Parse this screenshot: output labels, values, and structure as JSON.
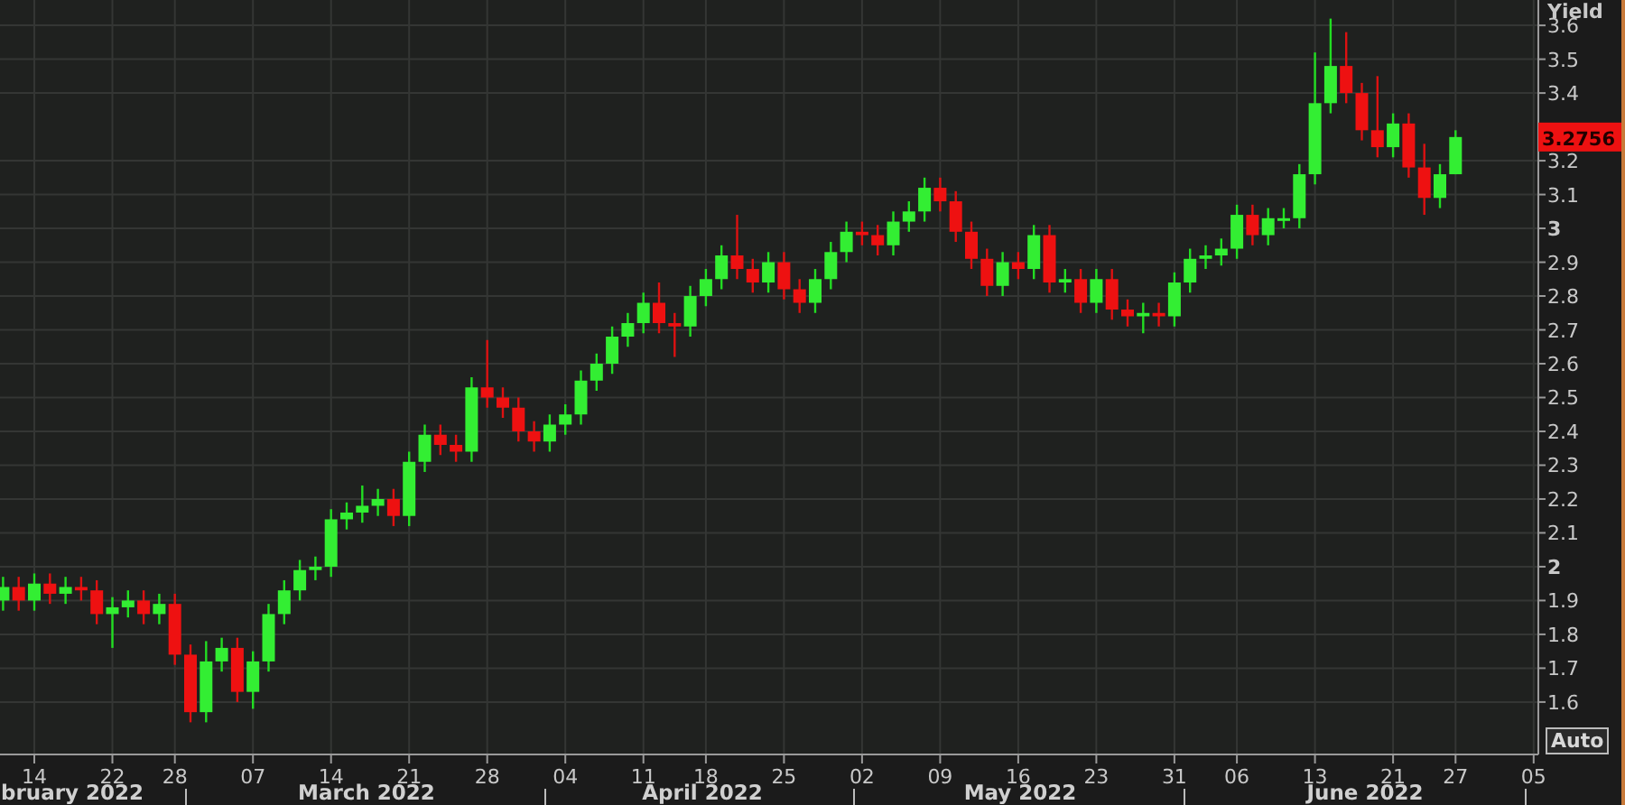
{
  "chart": {
    "last_price": "3.2756",
    "auto_button": "Auto",
    "months": [
      "bruary 2022",
      "March 2022",
      "April 2022",
      "May 2022",
      "June 2022"
    ],
    "chart_data": {
      "type": "candlestick",
      "ylabel": "Yield",
      "ylim": [
        1.445,
        3.675
      ],
      "grid": true,
      "yticks": [
        {
          "value": 1.6,
          "label": "1.6"
        },
        {
          "value": 1.7,
          "label": "1.7"
        },
        {
          "value": 1.8,
          "label": "1.8"
        },
        {
          "value": 1.9,
          "label": "1.9"
        },
        {
          "value": 2,
          "label": "2"
        },
        {
          "value": 2.1,
          "label": "2.1"
        },
        {
          "value": 2.2,
          "label": "2.2"
        },
        {
          "value": 2.3,
          "label": "2.3"
        },
        {
          "value": 2.4,
          "label": "2.4"
        },
        {
          "value": 2.5,
          "label": "2.5"
        },
        {
          "value": 2.6,
          "label": "2.6"
        },
        {
          "value": 2.7,
          "label": "2.7"
        },
        {
          "value": 2.8,
          "label": "2.8"
        },
        {
          "value": 2.9,
          "label": "2.9"
        },
        {
          "value": 3,
          "label": "3"
        },
        {
          "value": 3.1,
          "label": "3.1"
        },
        {
          "value": 3.2,
          "label": "3.2"
        },
        {
          "value": 3.4,
          "label": "3.4"
        },
        {
          "value": 3.5,
          "label": "3.5"
        },
        {
          "value": 3.6,
          "label": "3.6"
        }
      ],
      "categories": [
        null,
        null,
        "14",
        null,
        null,
        null,
        null,
        "22",
        null,
        null,
        null,
        "28",
        null,
        null,
        null,
        null,
        "07",
        null,
        null,
        null,
        null,
        "14",
        null,
        null,
        null,
        null,
        "21",
        null,
        null,
        null,
        null,
        "28",
        null,
        null,
        null,
        null,
        "04",
        null,
        null,
        null,
        null,
        "11",
        null,
        null,
        null,
        "18",
        null,
        null,
        null,
        null,
        "25",
        null,
        null,
        null,
        null,
        "02",
        null,
        null,
        null,
        null,
        "09",
        null,
        null,
        null,
        null,
        "16",
        null,
        null,
        null,
        null,
        "23",
        null,
        null,
        null,
        null,
        "31",
        null,
        null,
        null,
        "06",
        null,
        null,
        null,
        null,
        "13",
        null,
        null,
        null,
        null,
        "21",
        null,
        null,
        null,
        "27",
        null,
        null,
        null,
        null,
        "05"
      ],
      "ohlc": [
        [
          1.9,
          1.97,
          1.87,
          1.94
        ],
        [
          1.94,
          1.97,
          1.87,
          1.9
        ],
        [
          1.9,
          1.98,
          1.87,
          1.95
        ],
        [
          1.95,
          1.98,
          1.89,
          1.92
        ],
        [
          1.92,
          1.97,
          1.89,
          1.94
        ],
        [
          1.94,
          1.97,
          1.9,
          1.93
        ],
        [
          1.93,
          1.96,
          1.83,
          1.86
        ],
        [
          1.86,
          1.91,
          1.76,
          1.88
        ],
        [
          1.88,
          1.93,
          1.85,
          1.9
        ],
        [
          1.9,
          1.93,
          1.83,
          1.86
        ],
        [
          1.86,
          1.92,
          1.83,
          1.89
        ],
        [
          1.89,
          1.92,
          1.71,
          1.74
        ],
        [
          1.74,
          1.77,
          1.54,
          1.57
        ],
        [
          1.57,
          1.78,
          1.54,
          1.72
        ],
        [
          1.72,
          1.79,
          1.69,
          1.76
        ],
        [
          1.76,
          1.79,
          1.6,
          1.63
        ],
        [
          1.63,
          1.75,
          1.58,
          1.72
        ],
        [
          1.72,
          1.89,
          1.69,
          1.86
        ],
        [
          1.86,
          1.96,
          1.83,
          1.93
        ],
        [
          1.93,
          2.02,
          1.9,
          1.99
        ],
        [
          1.99,
          2.03,
          1.96,
          2.0
        ],
        [
          2.0,
          2.17,
          1.97,
          2.14
        ],
        [
          2.14,
          2.19,
          2.11,
          2.16
        ],
        [
          2.16,
          2.24,
          2.13,
          2.18
        ],
        [
          2.18,
          2.23,
          2.15,
          2.2
        ],
        [
          2.2,
          2.23,
          2.12,
          2.15
        ],
        [
          2.15,
          2.34,
          2.12,
          2.31
        ],
        [
          2.31,
          2.42,
          2.28,
          2.39
        ],
        [
          2.39,
          2.42,
          2.33,
          2.36
        ],
        [
          2.36,
          2.39,
          2.31,
          2.34
        ],
        [
          2.34,
          2.56,
          2.31,
          2.53
        ],
        [
          2.53,
          2.67,
          2.47,
          2.5
        ],
        [
          2.5,
          2.53,
          2.44,
          2.47
        ],
        [
          2.47,
          2.5,
          2.37,
          2.4
        ],
        [
          2.4,
          2.43,
          2.34,
          2.37
        ],
        [
          2.37,
          2.45,
          2.34,
          2.42
        ],
        [
          2.42,
          2.48,
          2.39,
          2.45
        ],
        [
          2.45,
          2.58,
          2.42,
          2.55
        ],
        [
          2.55,
          2.63,
          2.52,
          2.6
        ],
        [
          2.6,
          2.71,
          2.57,
          2.68
        ],
        [
          2.68,
          2.75,
          2.65,
          2.72
        ],
        [
          2.72,
          2.81,
          2.69,
          2.78
        ],
        [
          2.78,
          2.84,
          2.69,
          2.72
        ],
        [
          2.72,
          2.75,
          2.62,
          2.71
        ],
        [
          2.71,
          2.83,
          2.68,
          2.8
        ],
        [
          2.8,
          2.88,
          2.77,
          2.85
        ],
        [
          2.85,
          2.95,
          2.82,
          2.92
        ],
        [
          2.92,
          3.04,
          2.85,
          2.88
        ],
        [
          2.88,
          2.91,
          2.81,
          2.84
        ],
        [
          2.84,
          2.93,
          2.81,
          2.9
        ],
        [
          2.9,
          2.93,
          2.79,
          2.82
        ],
        [
          2.82,
          2.85,
          2.75,
          2.78
        ],
        [
          2.78,
          2.88,
          2.75,
          2.85
        ],
        [
          2.85,
          2.96,
          2.82,
          2.93
        ],
        [
          2.93,
          3.02,
          2.9,
          2.99
        ],
        [
          2.99,
          3.02,
          2.95,
          2.98
        ],
        [
          2.98,
          3.01,
          2.92,
          2.95
        ],
        [
          2.95,
          3.05,
          2.92,
          3.02
        ],
        [
          3.02,
          3.08,
          2.99,
          3.05
        ],
        [
          3.05,
          3.15,
          3.02,
          3.12
        ],
        [
          3.12,
          3.15,
          3.05,
          3.08
        ],
        [
          3.08,
          3.11,
          2.96,
          2.99
        ],
        [
          2.99,
          3.02,
          2.88,
          2.91
        ],
        [
          2.91,
          2.94,
          2.8,
          2.83
        ],
        [
          2.83,
          2.93,
          2.8,
          2.9
        ],
        [
          2.9,
          2.93,
          2.85,
          2.88
        ],
        [
          2.88,
          3.01,
          2.85,
          2.98
        ],
        [
          2.98,
          3.01,
          2.81,
          2.84
        ],
        [
          2.84,
          2.88,
          2.81,
          2.85
        ],
        [
          2.85,
          2.88,
          2.75,
          2.78
        ],
        [
          2.78,
          2.88,
          2.75,
          2.85
        ],
        [
          2.85,
          2.88,
          2.73,
          2.76
        ],
        [
          2.76,
          2.79,
          2.71,
          2.74
        ],
        [
          2.74,
          2.78,
          2.69,
          2.75
        ],
        [
          2.75,
          2.78,
          2.71,
          2.74
        ],
        [
          2.74,
          2.87,
          2.71,
          2.84
        ],
        [
          2.84,
          2.94,
          2.81,
          2.91
        ],
        [
          2.91,
          2.95,
          2.88,
          2.92
        ],
        [
          2.92,
          2.97,
          2.89,
          2.94
        ],
        [
          2.94,
          3.07,
          2.91,
          3.04
        ],
        [
          3.04,
          3.07,
          2.95,
          2.98
        ],
        [
          2.98,
          3.06,
          2.95,
          3.03
        ],
        [
          3.03,
          3.06,
          3.0,
          3.03
        ],
        [
          3.03,
          3.19,
          3.0,
          3.16
        ],
        [
          3.16,
          3.52,
          3.13,
          3.37
        ],
        [
          3.37,
          3.62,
          3.34,
          3.48
        ],
        [
          3.48,
          3.58,
          3.37,
          3.4
        ],
        [
          3.4,
          3.43,
          3.26,
          3.29
        ],
        [
          3.29,
          3.45,
          3.21,
          3.24
        ],
        [
          3.24,
          3.34,
          3.21,
          3.31
        ],
        [
          3.31,
          3.34,
          3.15,
          3.18
        ],
        [
          3.18,
          3.25,
          3.04,
          3.09
        ],
        [
          3.09,
          3.19,
          3.06,
          3.16
        ],
        [
          3.16,
          3.29,
          3.16,
          3.27
        ],
        null,
        null,
        null,
        null,
        null
      ]
    }
  }
}
